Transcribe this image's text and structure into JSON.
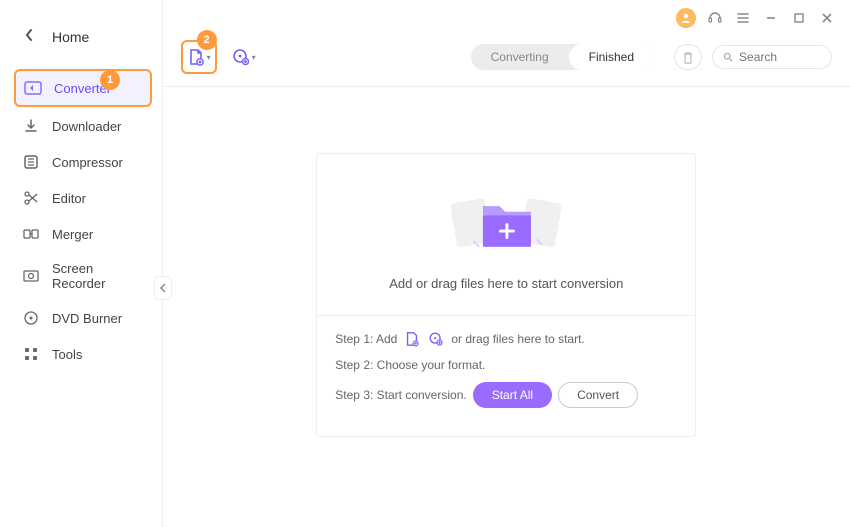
{
  "header": {
    "home": "Home"
  },
  "sidebar": {
    "items": [
      {
        "label": "Converter"
      },
      {
        "label": "Downloader"
      },
      {
        "label": "Compressor"
      },
      {
        "label": "Editor"
      },
      {
        "label": "Merger"
      },
      {
        "label": "Screen Recorder"
      },
      {
        "label": "DVD Burner"
      },
      {
        "label": "Tools"
      }
    ]
  },
  "callouts": {
    "one": "1",
    "two": "2"
  },
  "tabs": {
    "converting": "Converting",
    "finished": "Finished"
  },
  "search": {
    "placeholder": "Search"
  },
  "dropzone": {
    "title": "Add or drag files here to start conversion",
    "step1_prefix": "Step 1: Add",
    "step1_suffix": "or drag files here to start.",
    "step2": "Step 2: Choose your format.",
    "step3": "Step 3: Start conversion.",
    "start_all": "Start All",
    "convert": "Convert"
  }
}
